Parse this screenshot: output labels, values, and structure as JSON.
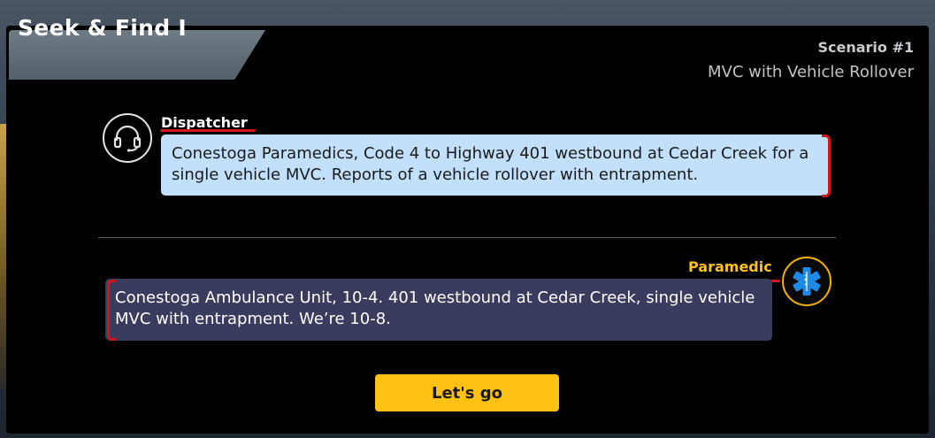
{
  "window": {
    "title": "Seek & Find I"
  },
  "scenario": {
    "label": "Scenario #1",
    "name": "MVC with Vehicle Rollover"
  },
  "dialogue": [
    {
      "speaker": "Dispatcher",
      "icon": "headset-icon",
      "text": "Conestoga Paramedics, Code 4 to Highway 401 westbound at Cedar Creek for a single vehicle MVC. Reports of a vehicle rollover with entrapment."
    },
    {
      "speaker": "Paramedic",
      "icon": "star-of-life-icon",
      "text": "Conestoga Ambulance Unit, 10-4. 401 westbound at Cedar Creek, single vehicle MVC with entrapment. We’re 10-8."
    }
  ],
  "actions": {
    "continue_label": "Let's go"
  },
  "colors": {
    "accent": "#ffc114",
    "dispatcher_bubble": "#c2e0fb",
    "paramedic_bubble": "#3a3c5e",
    "annotation_red": "#d0161b"
  }
}
